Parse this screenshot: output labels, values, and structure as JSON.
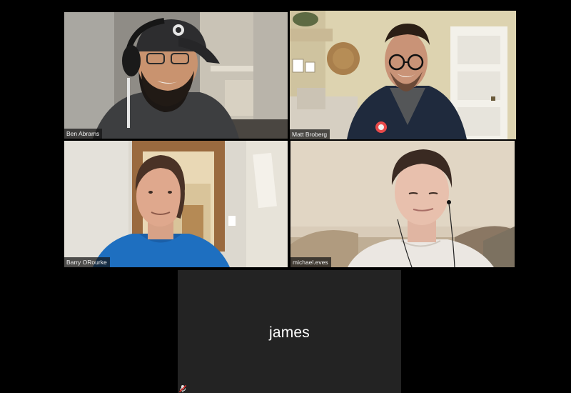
{
  "app": "Video conference gallery view",
  "participants": [
    {
      "name": "Ben Abrams",
      "video": true,
      "active_speaker": false
    },
    {
      "name": "Matt Broberg",
      "video": true,
      "active_speaker": true
    },
    {
      "name": "Barry ORourke",
      "video": true,
      "active_speaker": false
    },
    {
      "name": "michael.eves",
      "video": true,
      "active_speaker": false
    },
    {
      "name": "james",
      "video": false,
      "active_speaker": false,
      "audio_muted": true
    }
  ],
  "colors": {
    "background": "#000000",
    "tile_no_video": "#232323",
    "active_speaker_border": "#c8e04a",
    "name_tag_bg": "rgba(20,20,20,0.72)",
    "muted_icon": "#d6312e"
  },
  "icons": {
    "muted": "mic-muted-icon"
  }
}
